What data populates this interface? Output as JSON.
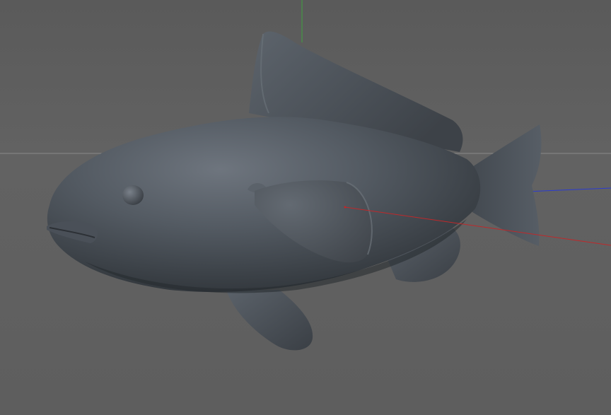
{
  "viewport": {
    "background": "#616161",
    "horizon_color": "#8a8a8a",
    "axes": {
      "x_color": "#c0282a",
      "y_color": "#3fa33f",
      "z_color": "#2b3bd1"
    },
    "model": {
      "name_icon": "fish-model",
      "body_color": "#4a5058",
      "body_highlight": "#6b727b",
      "body_shadow": "#2e3238"
    }
  }
}
